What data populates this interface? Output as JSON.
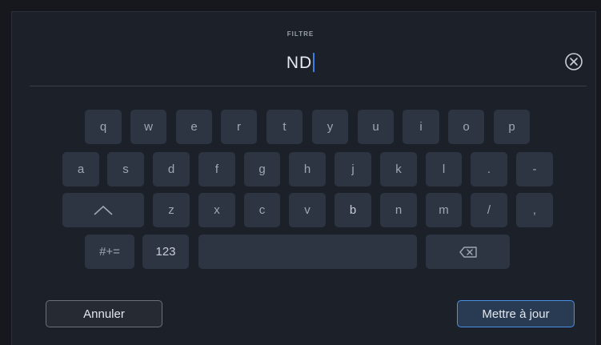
{
  "field": {
    "label": "FILTRE",
    "value": "ND"
  },
  "icons": {
    "clear": "circle-x-icon",
    "shift": "shift-up-arrow-icon",
    "backspace": "backspace-icon"
  },
  "keyboard": {
    "row1": [
      "q",
      "w",
      "e",
      "r",
      "t",
      "y",
      "u",
      "i",
      "o",
      "p"
    ],
    "row2": [
      "a",
      "s",
      "d",
      "f",
      "g",
      "h",
      "j",
      "k",
      "l",
      ".",
      "-"
    ],
    "row3": [
      "z",
      "x",
      "c",
      "v",
      "b",
      "n",
      "m",
      "/",
      ","
    ],
    "symbols": "#+=",
    "numbers": "123"
  },
  "buttons": {
    "cancel": "Annuler",
    "update": "Mettre à jour"
  },
  "colors": {
    "accent": "#3b7fe6",
    "background": "#1c2028",
    "key": "#2d3542"
  }
}
